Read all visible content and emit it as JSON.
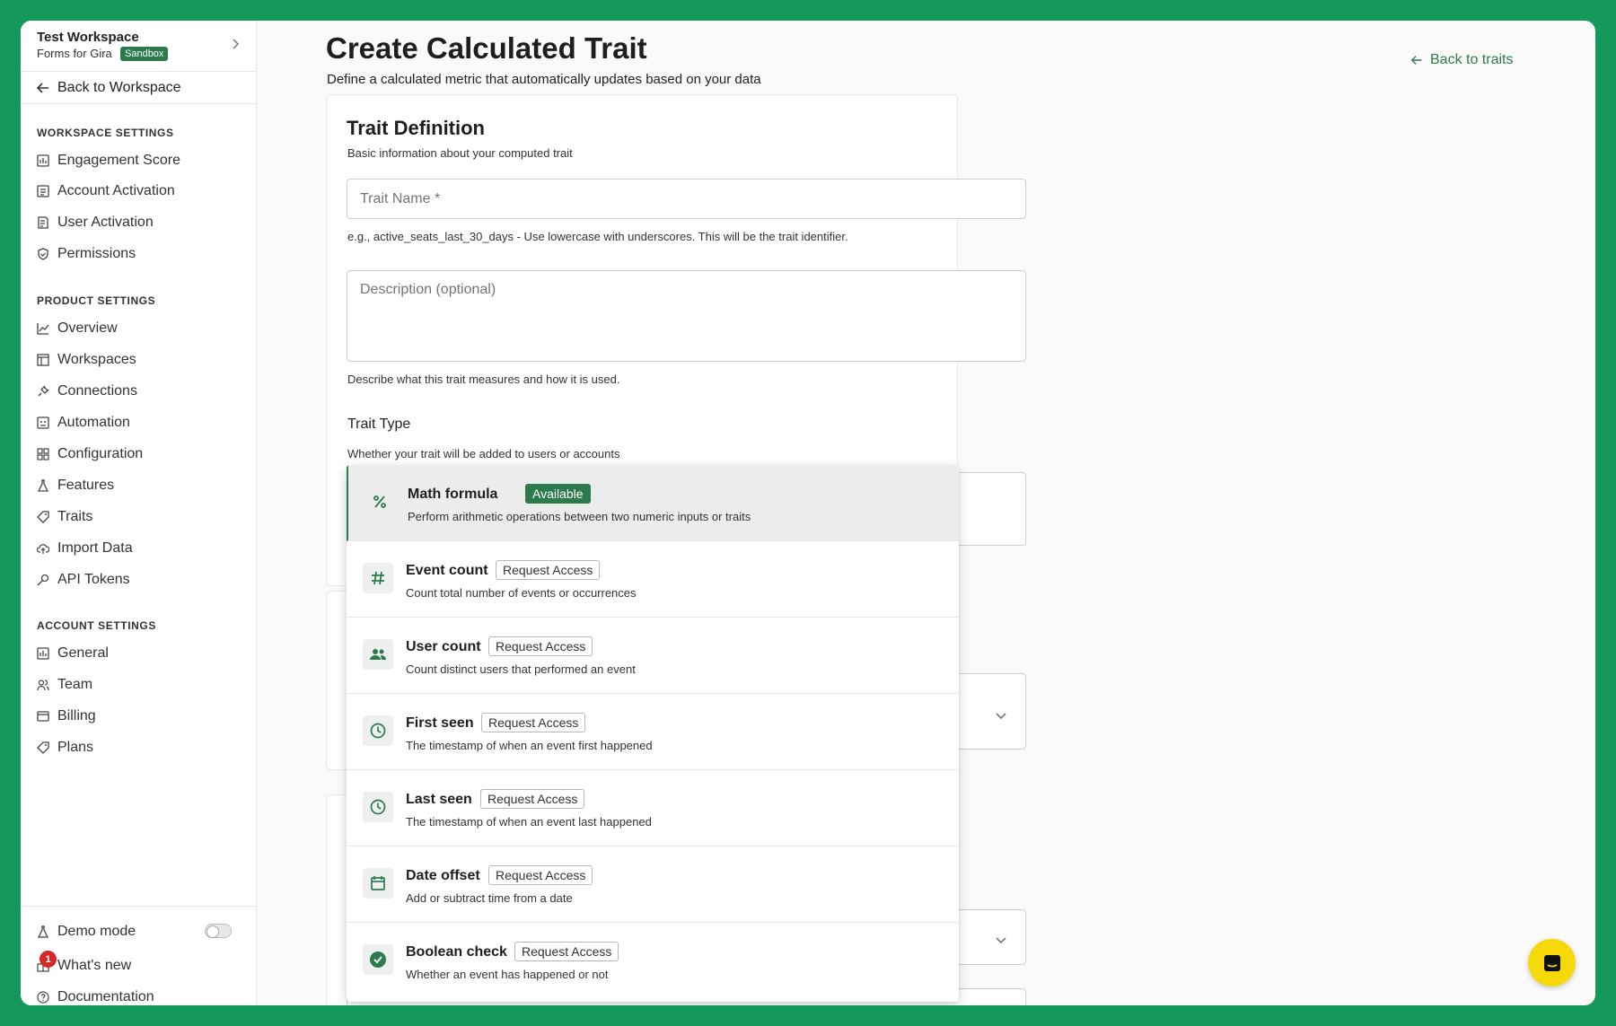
{
  "workspace": {
    "name": "Test Workspace",
    "subtitle": "Forms for Gira",
    "badge": "Sandbox",
    "back_label": "Back to Workspace"
  },
  "sidebar": {
    "workspace_settings": {
      "title": "WORKSPACE SETTINGS",
      "items": [
        {
          "label": "Engagement Score",
          "icon": "score-icon"
        },
        {
          "label": "Account Activation",
          "icon": "list-icon"
        },
        {
          "label": "User Activation",
          "icon": "doc-icon"
        },
        {
          "label": "Permissions",
          "icon": "shield-icon"
        }
      ]
    },
    "product_settings": {
      "title": "PRODUCT SETTINGS",
      "items": [
        {
          "label": "Overview",
          "icon": "chart-icon"
        },
        {
          "label": "Workspaces",
          "icon": "table-icon"
        },
        {
          "label": "Connections",
          "icon": "plug-icon"
        },
        {
          "label": "Automation",
          "icon": "robot-icon"
        },
        {
          "label": "Configuration",
          "icon": "grid-icon"
        },
        {
          "label": "Features",
          "icon": "flask-icon"
        },
        {
          "label": "Traits",
          "icon": "tag-icon"
        },
        {
          "label": "Import Data",
          "icon": "cloud-upload-icon"
        },
        {
          "label": "API Tokens",
          "icon": "key-icon"
        }
      ]
    },
    "account_settings": {
      "title": "ACCOUNT SETTINGS",
      "items": [
        {
          "label": "General",
          "icon": "score-icon"
        },
        {
          "label": "Team",
          "icon": "users-icon"
        },
        {
          "label": "Billing",
          "icon": "card-icon"
        },
        {
          "label": "Plans",
          "icon": "tag-icon"
        }
      ]
    },
    "bottom": {
      "demo_mode": "Demo mode",
      "demo_mode_on": false,
      "whats_new": "What's new",
      "whats_new_count": "1",
      "documentation": "Documentation"
    }
  },
  "header": {
    "title": "Create Calculated Trait",
    "subtitle": "Define a calculated metric that automatically updates based on your data",
    "back_link": "Back to traits"
  },
  "trait_definition": {
    "title": "Trait Definition",
    "subtitle": "Basic information about your computed trait",
    "name_placeholder": "Trait Name *",
    "name_value": "",
    "name_helper": "e.g., active_seats_last_30_days - Use lowercase with underscores. This will be the trait identifier.",
    "description_placeholder": "Description (optional)",
    "description_value": "",
    "description_helper": "Describe what this trait measures and how it is used.",
    "type_label": "Trait Type",
    "type_helper": "Whether your trait will be added to users or accounts"
  },
  "dropdown": {
    "options": [
      {
        "title": "Math formula",
        "tag": "Available",
        "desc": "Perform arithmetic operations between two numeric inputs or traits",
        "icon": "percent-icon",
        "selected": true
      },
      {
        "title": "Event count",
        "tag": "Request Access",
        "desc": "Count total number of events or occurrences",
        "icon": "hash-icon",
        "selected": false
      },
      {
        "title": "User count",
        "tag": "Request Access",
        "desc": "Count distinct users that performed an event",
        "icon": "people-icon",
        "selected": false
      },
      {
        "title": "First seen",
        "tag": "Request Access",
        "desc": "The timestamp of when an event first happened",
        "icon": "clock-icon",
        "selected": false
      },
      {
        "title": "Last seen",
        "tag": "Request Access",
        "desc": "The timestamp of when an event last happened",
        "icon": "clock-icon",
        "selected": false
      },
      {
        "title": "Date offset",
        "tag": "Request Access",
        "desc": "Add or subtract time from a date",
        "icon": "calendar-icon",
        "selected": false
      },
      {
        "title": "Boolean check",
        "tag": "Request Access",
        "desc": "Whether an event has happened or not",
        "icon": "check-circle-icon",
        "selected": false
      }
    ]
  },
  "colors": {
    "accent": "#2d7a4f",
    "frame": "#14995a",
    "chat": "#f5d90a",
    "notification": "#d62828"
  }
}
